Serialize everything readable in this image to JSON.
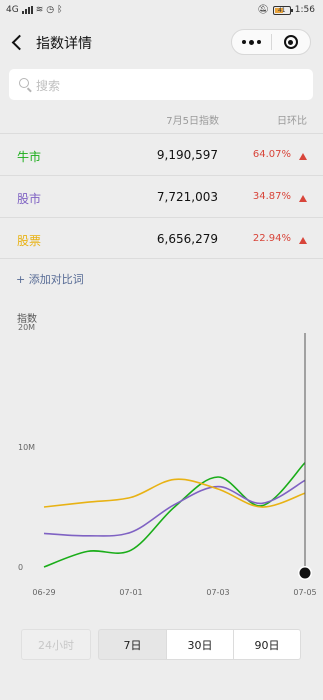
{
  "status_bar": {
    "network": "4G",
    "battery": "41",
    "time": "1:56"
  },
  "nav": {
    "title": "指数详情"
  },
  "search": {
    "placeholder": "搜索"
  },
  "table": {
    "header_index": "7月5日指数",
    "header_change": "日环比",
    "rows": [
      {
        "name": "牛市",
        "value": "9,190,597",
        "change": "64.07%",
        "color": "#1aad19"
      },
      {
        "name": "股市",
        "value": "7,721,003",
        "change": "34.87%",
        "color": "#7f62c3"
      },
      {
        "name": "股票",
        "value": "6,656,279",
        "change": "22.94%",
        "color": "#e8b214"
      }
    ]
  },
  "add_compare": "+ 添加对比词",
  "chart_label": "指数",
  "chart_data": {
    "type": "line",
    "title": "",
    "ylabel": "指数",
    "ylim": [
      0,
      20000000
    ],
    "y_ticks": [
      "20M",
      "10M",
      "0"
    ],
    "y_tick_values": [
      20000000,
      10000000,
      0
    ],
    "x": [
      "06-29",
      "06-30",
      "07-01",
      "07-02",
      "07-03",
      "07-04",
      "07-05"
    ],
    "x_tick_labels": [
      "06-29",
      "07-01",
      "07-03",
      "07-05"
    ],
    "series": [
      {
        "name": "牛市",
        "color": "#1aad19",
        "values": [
          500000,
          1800000,
          1900000,
          5500000,
          8000000,
          5600000,
          9190597
        ]
      },
      {
        "name": "股市",
        "color": "#7f62c3",
        "values": [
          3300000,
          3100000,
          3400000,
          5700000,
          7200000,
          5800000,
          7721003
        ]
      },
      {
        "name": "股票",
        "color": "#e8b214",
        "values": [
          5500000,
          5900000,
          6300000,
          7800000,
          7000000,
          5500000,
          6656279
        ]
      }
    ],
    "grid": false
  },
  "ranges": [
    "24小时",
    "7日",
    "30日",
    "90日"
  ]
}
